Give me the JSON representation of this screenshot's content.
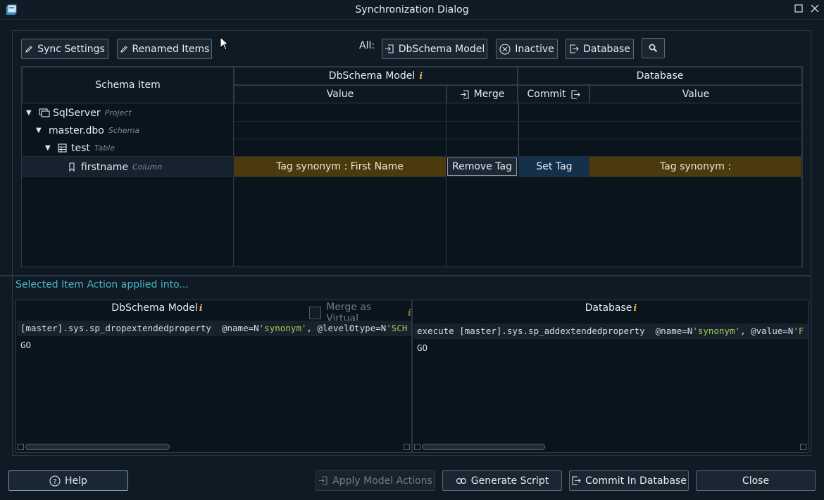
{
  "window": {
    "title": "Synchronization Dialog"
  },
  "toolbar": {
    "sync_settings_label": "Sync Settings",
    "renamed_items_label": "Renamed Items",
    "all_label": "All:",
    "dbschema_model_label": "DbSchema Model",
    "inactive_label": "Inactive",
    "database_label": "Database"
  },
  "grid": {
    "headers": {
      "schema_item": "Schema Item",
      "dbschema_model": "DbSchema Model",
      "database": "Database",
      "value_left": "Value",
      "merge": "Merge",
      "commit": "Commit",
      "value_right": "Value"
    },
    "rows": [
      {
        "name": "SqlServer",
        "type": "Project"
      },
      {
        "name": "master.dbo",
        "type": "Schema"
      },
      {
        "name": "test",
        "type": "Table"
      },
      {
        "name": "firstname",
        "type": "Column"
      }
    ],
    "selected": {
      "model_value": "Tag synonym : First Name",
      "merge_action": "Remove Tag",
      "commit_action": "Set Tag",
      "database_value": "Tag synonym :"
    }
  },
  "actions": {
    "section_label": "Selected Item Action applied into...",
    "model_pane": {
      "title": "DbSchema Model",
      "merge_virtual_label": "Merge as Virtual",
      "line1_prefix": "[master].sys.sp_dropextendedproperty  @name=N",
      "line1_str1": "'synonym'",
      "line1_mid": ", @level0type=N",
      "line1_str2": "'SCH",
      "line2": "GO"
    },
    "db_pane": {
      "title": "Database",
      "line1_prefix": "execute [master].sys.sp_addextendedproperty  @name=N",
      "line1_str1": "'synonym'",
      "line1_mid": ", @value=N",
      "line1_str2": "'F",
      "line2": "GO"
    }
  },
  "footer": {
    "help_label": "Help",
    "apply_label": "Apply Model Actions",
    "generate_label": "Generate Script",
    "commit_label": "Commit In Database",
    "close_label": "Close"
  },
  "colors": {
    "accent": "#49b6c8",
    "selected_row": "#4a3a0c",
    "string": "#9bd154",
    "info": "#e5b44a"
  }
}
